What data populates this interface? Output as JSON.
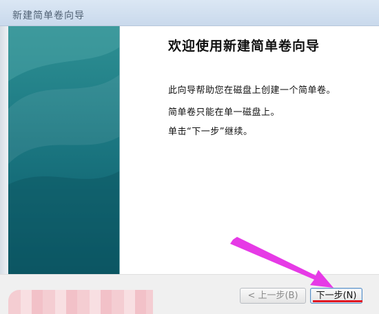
{
  "window": {
    "title": "新建简单卷向导"
  },
  "content": {
    "heading": "欢迎使用新建简单卷向导",
    "lines": [
      "此向导帮助您在磁盘上创建一个简单卷。",
      "简单卷只能在单一磁盘上。",
      "单击“下一步”继续。"
    ]
  },
  "buttons": {
    "back_label": "< 上一步(B)",
    "next_label": "下一步(N)"
  },
  "colors": {
    "panel_teal": "#1f7d86",
    "annotation_arrow": "#e63ae6",
    "annotation_underline": "#e01020"
  }
}
